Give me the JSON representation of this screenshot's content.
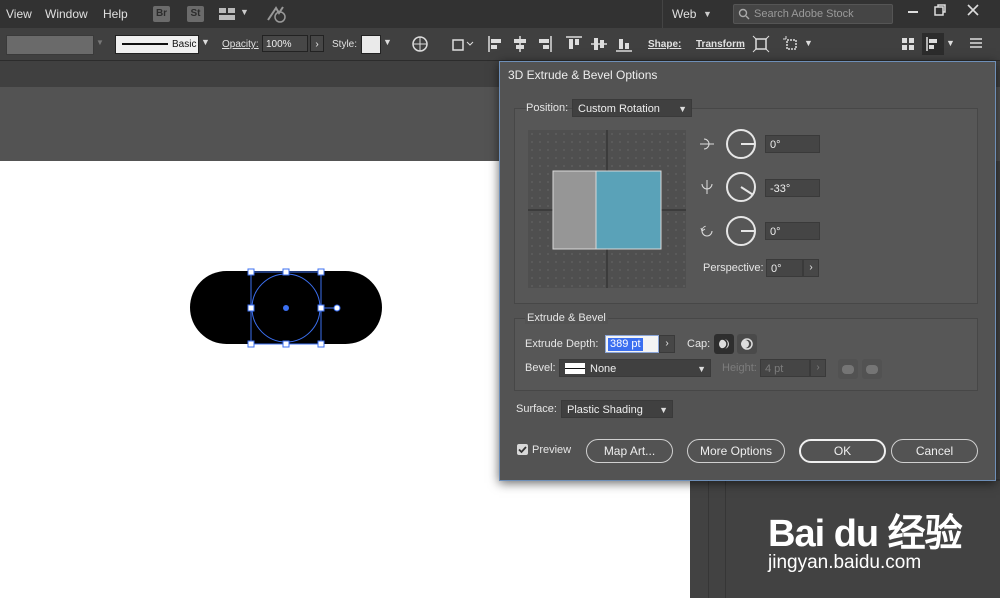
{
  "menubar": {
    "items": [
      "View",
      "Window",
      "Help"
    ],
    "bridge_label": "Br",
    "stock_label": "St",
    "workspace": "Web",
    "search_placeholder": "Search Adobe Stock"
  },
  "controlbar": {
    "stroke_style": "Basic",
    "opacity_label": "Opacity:",
    "opacity_value": "100%",
    "style_label": "Style:",
    "shape_label": "Shape:",
    "transform_label": "Transform"
  },
  "dialog": {
    "title": "3D Extrude & Bevel Options",
    "position_label": "Position:",
    "position_value": "Custom Rotation",
    "rot_x": "0°",
    "rot_y": "-33°",
    "rot_z": "0°",
    "perspective_label": "Perspective:",
    "perspective_value": "0°",
    "extrude_section": "Extrude & Bevel",
    "extrude_depth_label": "Extrude Depth:",
    "extrude_depth_value": "389 pt",
    "cap_label": "Cap:",
    "bevel_label": "Bevel:",
    "bevel_value": "None",
    "height_label": "Height:",
    "height_value": "4 pt",
    "surface_label": "Surface:",
    "surface_value": "Plastic Shading",
    "preview_label": "Preview",
    "map_art_label": "Map Art...",
    "more_options_label": "More Options",
    "ok_label": "OK",
    "cancel_label": "Cancel"
  },
  "preview_cube": {
    "left_face_color": "#969696",
    "front_face_color": "#5aa2b8"
  },
  "watermark": {
    "logo_text": "Bai du 经验",
    "url": "jingyan.baidu.com"
  },
  "colors": {
    "accent_selection": "#3b6ff0",
    "dialog_border": "#6e8fb8"
  }
}
